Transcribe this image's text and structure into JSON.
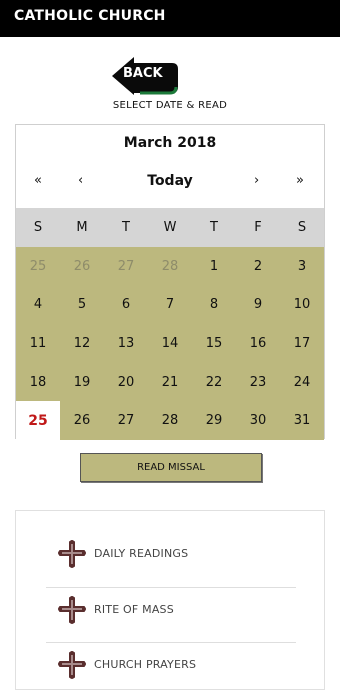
{
  "app": {
    "title": "CATHOLIC CHURCH"
  },
  "back_button": {
    "label": "BACK"
  },
  "instruction": "SELECT DATE & READ",
  "calendar": {
    "month_label": "March 2018",
    "nav": {
      "first": "«",
      "prev": "‹",
      "today": "Today",
      "next": "›",
      "last": "»"
    },
    "weekdays": [
      "S",
      "M",
      "T",
      "W",
      "T",
      "F",
      "S"
    ],
    "days": [
      {
        "label": "25",
        "muted": true
      },
      {
        "label": "26",
        "muted": true
      },
      {
        "label": "27",
        "muted": true
      },
      {
        "label": "28",
        "muted": true
      },
      {
        "label": "1"
      },
      {
        "label": "2"
      },
      {
        "label": "3"
      },
      {
        "label": "4"
      },
      {
        "label": "5"
      },
      {
        "label": "6"
      },
      {
        "label": "7"
      },
      {
        "label": "8"
      },
      {
        "label": "9"
      },
      {
        "label": "10"
      },
      {
        "label": "11"
      },
      {
        "label": "12"
      },
      {
        "label": "13"
      },
      {
        "label": "14"
      },
      {
        "label": "15"
      },
      {
        "label": "16"
      },
      {
        "label": "17"
      },
      {
        "label": "18"
      },
      {
        "label": "19"
      },
      {
        "label": "20"
      },
      {
        "label": "21"
      },
      {
        "label": "22"
      },
      {
        "label": "23"
      },
      {
        "label": "24"
      },
      {
        "label": "25",
        "today": true
      },
      {
        "label": "26"
      },
      {
        "label": "27"
      },
      {
        "label": "28"
      },
      {
        "label": "29"
      },
      {
        "label": "30"
      },
      {
        "label": "31"
      }
    ]
  },
  "read_missal_button": {
    "label": "READ MISSAL"
  },
  "menu": {
    "items": [
      {
        "label": "DAILY READINGS",
        "icon": "cross-icon"
      },
      {
        "label": "RITE OF MASS",
        "icon": "cross-icon"
      },
      {
        "label": "CHURCH PRAYERS",
        "icon": "cross-icon"
      }
    ]
  },
  "colors": {
    "topbar": "#000000",
    "calendar_grid": "#bcb87e",
    "weekday_header": "#d5d5d5",
    "today_text": "#c01818",
    "cross_dark": "#5a2e2e",
    "cross_light": "#a88c8c"
  }
}
